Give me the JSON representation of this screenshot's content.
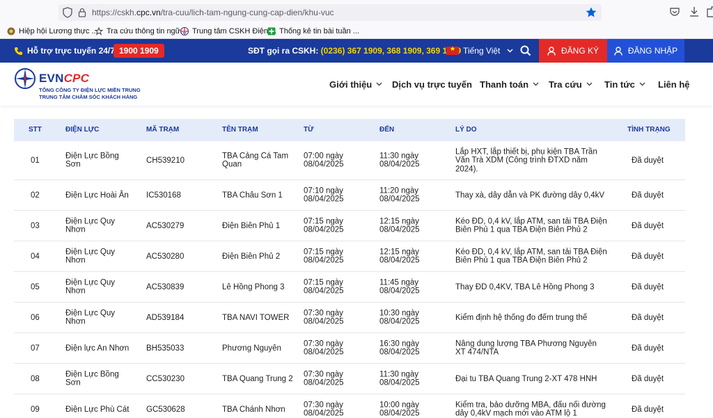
{
  "browser": {
    "url_prefix": "https://cskh.",
    "url_domain": "cpc.vn",
    "url_path": "/tra-cuu/lich-tam-ngung-cung-cap-dien/khu-vuc",
    "bookmarks": [
      {
        "label": "Hiệp hội Lương thực ...",
        "icon": "grain-icon"
      },
      {
        "label": "Tra cứu thông tin ngữ...",
        "icon": "star-bookmark-icon"
      },
      {
        "label": "Trung tâm CSKH Điện ...",
        "icon": "evn-logo-icon"
      },
      {
        "label": "Thống kê tin bài tuần ...",
        "icon": "plus-green-icon"
      }
    ]
  },
  "topbar": {
    "support_label": "Hỗ trợ trực tuyến 24/7:",
    "hotline": "1900 1909",
    "cskh_label": "SĐT gọi ra CSKH: ",
    "cskh_numbers": "(0236) 367 1909, 368 1909, 369 1909",
    "language": "Tiếng Việt",
    "register_label": "ĐĂNG KÝ",
    "login_label": "ĐĂNG NHẬP"
  },
  "logo": {
    "brand_evn": "EVN",
    "brand_cpc": "CPC",
    "line1": "TỔNG CÔNG TY ĐIỆN LỰC MIỀN TRUNG",
    "line2": "TRUNG TÂM CHĂM SÓC KHÁCH HÀNG"
  },
  "nav": {
    "items": [
      {
        "label": "Giới thiệu",
        "dropdown": true
      },
      {
        "label": "Dịch vụ trực tuyến",
        "dropdown": false
      },
      {
        "label": "Thanh toán",
        "dropdown": true
      },
      {
        "label": "Tra cứu",
        "dropdown": true
      },
      {
        "label": "Tin tức",
        "dropdown": true
      },
      {
        "label": "Liên hệ",
        "dropdown": false
      }
    ]
  },
  "table": {
    "headers": [
      "STT",
      "ĐIỆN LỰC",
      "MÃ TRẠM",
      "TÊN TRẠM",
      "TỪ",
      "ĐẾN",
      "LÝ DO",
      "TÌNH TRẠNG"
    ],
    "rows": [
      {
        "stt": "01",
        "dien_luc": "Điện Lực Bồng Sơn",
        "ma_tram": "CH539210",
        "ten_tram": "TBA Cảng Cá Tam Quan",
        "tu": "07:00 ngày 08/04/2025",
        "den": "11:30 ngày 08/04/2025",
        "ly_do": "Lắp HXT, lắp thiết bị, phụ kiện TBA Trần Văn Trà XDM (Công trình ĐTXD năm 2024).",
        "tinh_trang": "Đã duyệt"
      },
      {
        "stt": "02",
        "dien_luc": "Điện Lực Hoài Ân",
        "ma_tram": "IC530168",
        "ten_tram": "TBA Châu Sơn 1",
        "tu": "07:10 ngày 08/04/2025",
        "den": "11:20 ngày 08/04/2025",
        "ly_do": "Thay xà, dây dẫn và PK đường dây 0,4kV",
        "tinh_trang": "Đã duyệt"
      },
      {
        "stt": "03",
        "dien_luc": "Điện Lực Quy Nhơn",
        "ma_tram": "AC530279",
        "ten_tram": "Điện Biên Phủ 1",
        "tu": "07:15 ngày 08/04/2025",
        "den": "12:15 ngày 08/04/2025",
        "ly_do": "Kéo ĐD, 0,4 kV, lắp ATM, san tải TBA Điện Biên Phủ 1 qua TBA Điện Biên Phủ 2",
        "tinh_trang": "Đã duyệt"
      },
      {
        "stt": "04",
        "dien_luc": "Điện Lực Quy Nhơn",
        "ma_tram": "AC530280",
        "ten_tram": "Điện Biên Phủ 2",
        "tu": "07:15 ngày 08/04/2025",
        "den": "12:15 ngày 08/04/2025",
        "ly_do": "Kéo ĐD, 0,4 kV, lắp ATM, san tải TBA Điện Biên Phủ 1 qua TBA Điện Biên Phủ 2",
        "tinh_trang": "Đã duyệt"
      },
      {
        "stt": "05",
        "dien_luc": "Điện Lực Quy Nhơn",
        "ma_tram": "AC530839",
        "ten_tram": "Lê Hồng Phong 3",
        "tu": "07:15 ngày 08/04/2025",
        "den": "11:45 ngày 08/04/2025",
        "ly_do": "Thay ĐD 0,4KV, TBA Lê Hồng Phong 3",
        "tinh_trang": "Đã duyệt"
      },
      {
        "stt": "06",
        "dien_luc": "Điện Lực Quy Nhơn",
        "ma_tram": "AD539184",
        "ten_tram": "TBA NAVI TOWER",
        "tu": "07:30 ngày 08/04/2025",
        "den": "10:30 ngày 08/04/2025",
        "ly_do": "Kiểm định hệ thống đo đếm trung thế",
        "tinh_trang": "Đã duyệt"
      },
      {
        "stt": "07",
        "dien_luc": "Điện lực An Nhơn",
        "ma_tram": "BH535033",
        "ten_tram": "Phương Nguyên",
        "tu": "07:30 ngày 08/04/2025",
        "den": "16:30 ngày 08/04/2025",
        "ly_do": "Nâng dung lượng TBA Phương Nguyên XT 474/NTA",
        "tinh_trang": "Đã duyệt"
      },
      {
        "stt": "08",
        "dien_luc": "Điện Lực Bồng Sơn",
        "ma_tram": "CC530230",
        "ten_tram": "TBA Quang Trung 2",
        "tu": "07:30 ngày 08/04/2025",
        "den": "11:30 ngày 08/04/2025",
        "ly_do": "Đại tu TBA Quang Trung 2-XT 478 HNH",
        "tinh_trang": "Đã duyệt"
      },
      {
        "stt": "09",
        "dien_luc": "Điện Lực Phù Cát",
        "ma_tram": "GC530628",
        "ten_tram": "TBA Chánh Nhơn",
        "tu": "07:30 ngày 08/04/2025",
        "den": "10:00 ngày 08/04/2025",
        "ly_do": "Kiểm tra, bảo dưỡng MBA, đấu nối đường dây 0,4kV mạch mới vào ATM lộ 1",
        "tinh_trang": "Đã duyệt"
      }
    ]
  },
  "colors": {
    "brand_blue": "#1a3a9c",
    "register_red": "#e42a28",
    "login_blue": "#2251d8",
    "phone_yellow": "#f5d400",
    "table_header_bg": "#e4ebf9"
  }
}
